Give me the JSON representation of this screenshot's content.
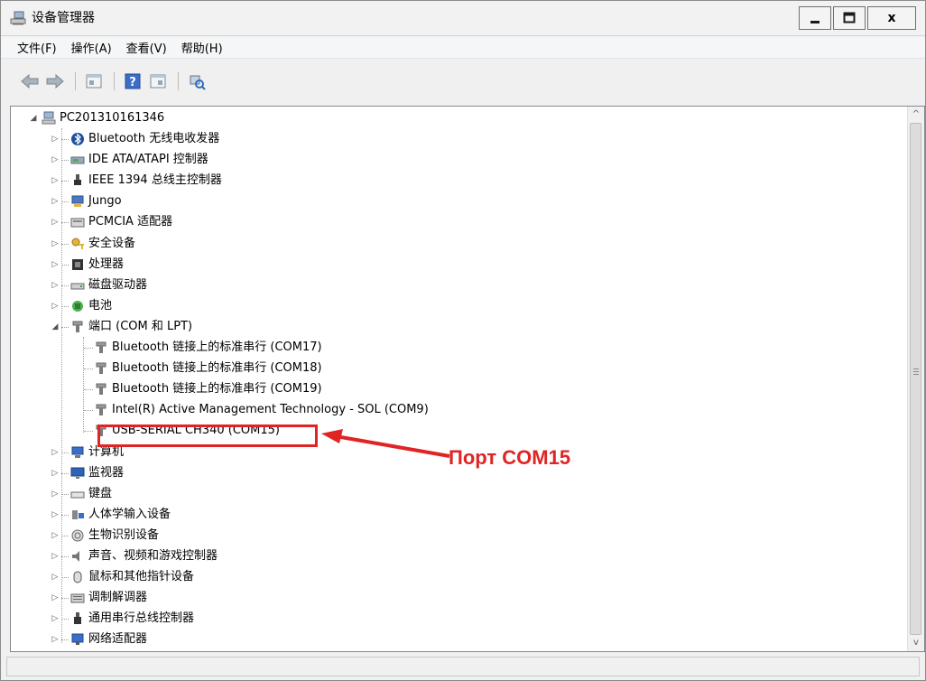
{
  "window": {
    "title": "设备管理器"
  },
  "menu": [
    "文件(F)",
    "操作(A)",
    "查看(V)",
    "帮助(H)"
  ],
  "toolbar": [
    "back-icon",
    "forward-icon",
    "properties-icon",
    "help-icon",
    "show-hidden-icon",
    "scan-hardware-icon"
  ],
  "tree": {
    "root": "PC201310161346",
    "items": [
      {
        "label": "Bluetooth 无线电收发器",
        "icon": "bluetooth-icon"
      },
      {
        "label": "IDE ATA/ATAPI 控制器",
        "icon": "ide-controller-icon"
      },
      {
        "label": "IEEE 1394 总线主控制器",
        "icon": "ieee1394-icon"
      },
      {
        "label": "Jungo",
        "icon": "jungo-icon"
      },
      {
        "label": "PCMCIA 适配器",
        "icon": "pcmcia-icon"
      },
      {
        "label": "安全设备",
        "icon": "security-device-icon"
      },
      {
        "label": "处理器",
        "icon": "processor-icon"
      },
      {
        "label": "磁盘驱动器",
        "icon": "disk-drive-icon"
      },
      {
        "label": "电池",
        "icon": "battery-icon"
      },
      {
        "label": "端口 (COM 和 LPT)",
        "icon": "port-icon",
        "expanded": true
      },
      {
        "label": "Bluetooth 链接上的标准串行 (COM17)",
        "icon": "port-icon",
        "child": true
      },
      {
        "label": "Bluetooth 链接上的标准串行 (COM18)",
        "icon": "port-icon",
        "child": true
      },
      {
        "label": "Bluetooth 链接上的标准串行 (COM19)",
        "icon": "port-icon",
        "child": true
      },
      {
        "label": "Intel(R) Active Management Technology - SOL (COM9)",
        "icon": "port-icon",
        "child": true
      },
      {
        "label": "USB-SERIAL CH340 (COM15)",
        "icon": "port-icon",
        "child": true
      },
      {
        "label": "计算机",
        "icon": "computer-icon"
      },
      {
        "label": "监视器",
        "icon": "monitor-icon"
      },
      {
        "label": "键盘",
        "icon": "keyboard-icon"
      },
      {
        "label": "人体学输入设备",
        "icon": "hid-icon"
      },
      {
        "label": "生物识别设备",
        "icon": "biometric-icon"
      },
      {
        "label": "声音、视频和游戏控制器",
        "icon": "sound-icon"
      },
      {
        "label": "鼠标和其他指针设备",
        "icon": "mouse-icon"
      },
      {
        "label": "调制解调器",
        "icon": "modem-icon"
      },
      {
        "label": "通用串行总线控制器",
        "icon": "usb-icon"
      },
      {
        "label": "网络适配器",
        "icon": "network-adapter-icon"
      }
    ]
  },
  "annotation": {
    "label": "Порт COM15",
    "color": "#e02424"
  }
}
